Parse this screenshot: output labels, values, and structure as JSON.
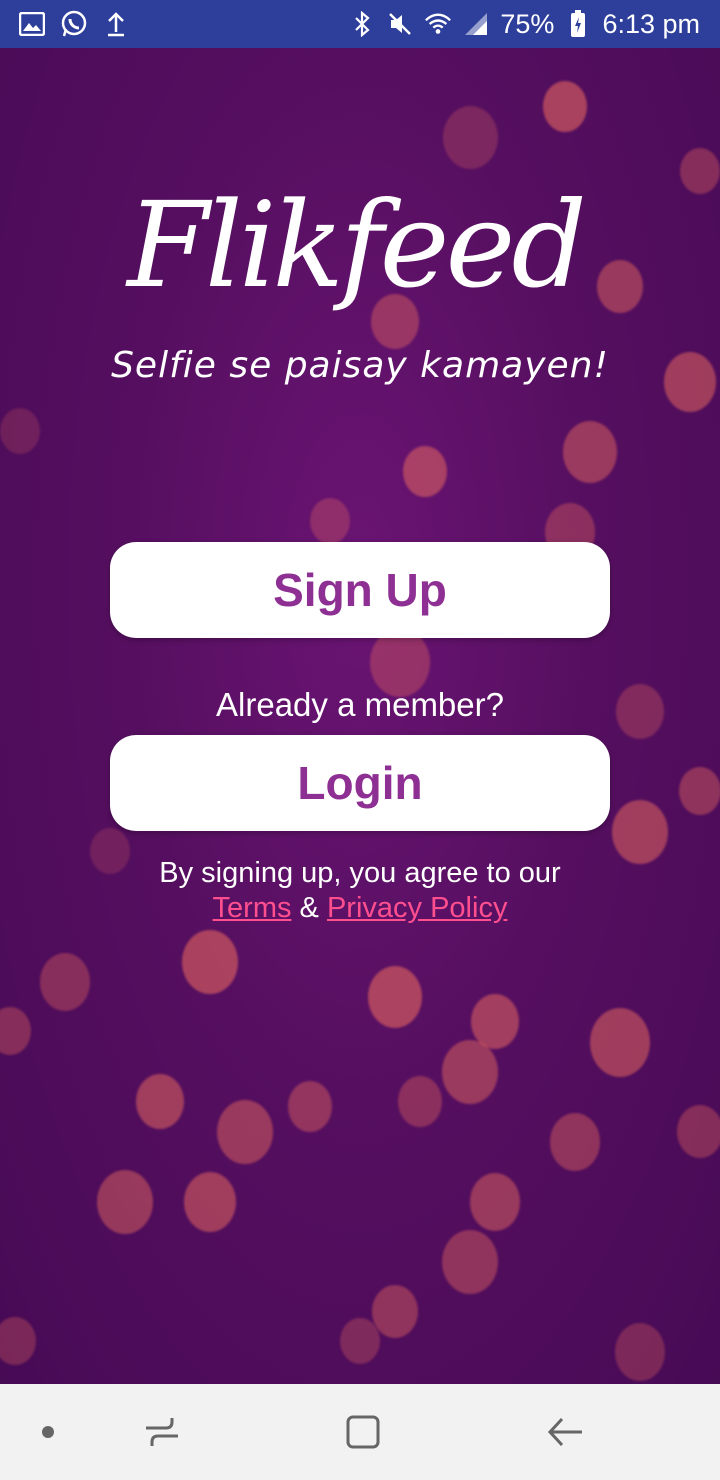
{
  "status_bar": {
    "left_icons": [
      "image-icon",
      "whatsapp-icon",
      "upload-icon"
    ],
    "right_icons": [
      "bluetooth-icon",
      "mute-icon",
      "wifi-icon",
      "signal-icon",
      "battery-charging-icon"
    ],
    "battery_percent": "75%",
    "time": "6:13 pm"
  },
  "brand": {
    "logo_text": "Flikfeed",
    "tagline": "Selfie se paisay kamayen!"
  },
  "actions": {
    "signup_label": "Sign Up",
    "member_prompt": "Already a member?",
    "login_label": "Login"
  },
  "legal": {
    "prefix": "By signing up, you agree to our",
    "terms_link": "Terms",
    "ampersand": "&",
    "privacy_link": "Privacy Policy"
  },
  "nav_bar": {
    "icons": [
      "dot-icon",
      "recent-apps-icon",
      "home-icon",
      "back-icon"
    ]
  },
  "colors": {
    "status_bar": "#2d3e9b",
    "background": "#5a0f63",
    "button_text": "#8e2f93",
    "link": "#ff4f8f"
  }
}
